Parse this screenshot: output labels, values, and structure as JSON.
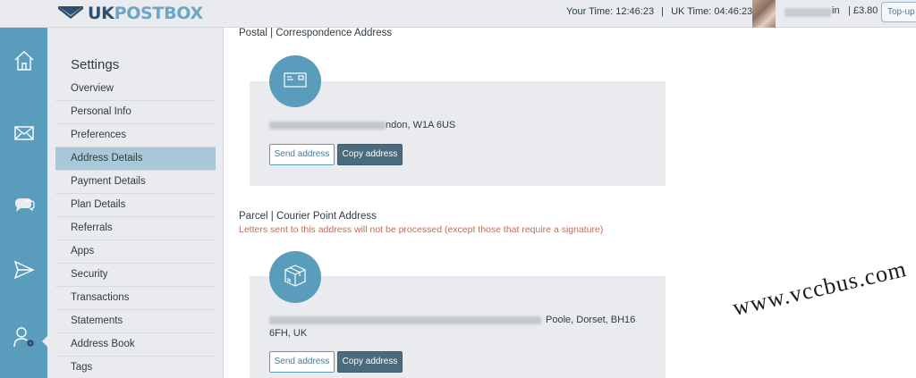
{
  "header": {
    "logo_uk": "UK",
    "logo_postbox": "POSTBOX",
    "your_time_label": "Your Time:",
    "your_time": "12:46:23",
    "uk_time_label": "UK Time:",
    "uk_time": "04:46:23",
    "user_suffix": "in",
    "balance": "£3.80",
    "topup_label": "Top-up"
  },
  "rail": {
    "items": [
      {
        "name": "home-icon"
      },
      {
        "name": "mail-icon"
      },
      {
        "name": "chat-icon"
      },
      {
        "name": "send-icon"
      },
      {
        "name": "user-settings-icon"
      }
    ]
  },
  "settings": {
    "title": "Settings",
    "items": [
      {
        "label": "Overview",
        "active": false
      },
      {
        "label": "Personal Info",
        "active": false
      },
      {
        "label": "Preferences",
        "active": false
      },
      {
        "label": "Address Details",
        "active": true
      },
      {
        "label": "Payment Details",
        "active": false
      },
      {
        "label": "Plan Details",
        "active": false
      },
      {
        "label": "Referrals",
        "active": false
      },
      {
        "label": "Apps",
        "active": false
      },
      {
        "label": "Security",
        "active": false
      },
      {
        "label": "Transactions",
        "active": false
      },
      {
        "label": "Statements",
        "active": false
      },
      {
        "label": "Address Book",
        "active": false
      },
      {
        "label": "Tags",
        "active": false
      }
    ]
  },
  "postal": {
    "title": "Postal | Correspondence Address",
    "address_visible": "ndon, W1A 6US",
    "send_label": "Send address",
    "copy_label": "Copy address"
  },
  "parcel": {
    "title": "Parcel | Courier Point Address",
    "warning": "Letters sent to this address will not be processed (except those that require a signature)",
    "address_line1_visible": "Poole, Dorset, BH16",
    "address_line2_visible": "6FH, UK",
    "send_label": "Send address",
    "copy_label": "Copy address"
  },
  "watermark": "www.vccbus.com",
  "colors": {
    "accent": "#5a9cbb",
    "sidebar_bg": "#e9ebee",
    "active_item": "#a8c8d8",
    "solid_button": "#4a6a7e",
    "warning_text": "#c96a4e"
  }
}
